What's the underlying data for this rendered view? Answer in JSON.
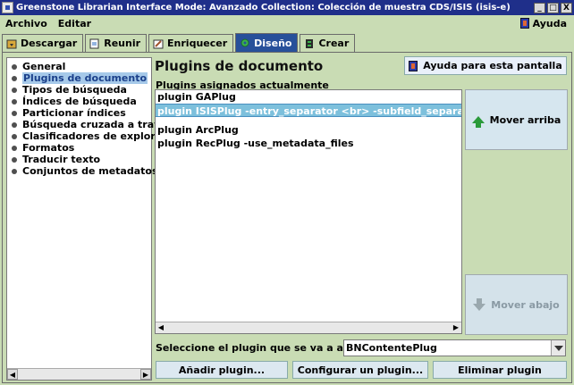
{
  "window": {
    "title": "Greenstone Librarian Interface  Mode: Avanzado  Collection: Colección de muestra CDS/ISIS (isis-e)",
    "minimize": "_",
    "maximize": "□",
    "close": "X"
  },
  "menu": {
    "file": "Archivo",
    "edit": "Editar",
    "help": "Ayuda"
  },
  "tabs": [
    {
      "label": "Descargar"
    },
    {
      "label": "Reunir"
    },
    {
      "label": "Enriquecer"
    },
    {
      "label": "Diseño"
    },
    {
      "label": "Crear"
    }
  ],
  "sidebar": {
    "items": [
      {
        "label": "General"
      },
      {
        "label": "Plugins de documento"
      },
      {
        "label": "Tipos de búsqueda"
      },
      {
        "label": "Índices de búsqueda"
      },
      {
        "label": "Particionar índices"
      },
      {
        "label": "Búsqueda cruzada a través"
      },
      {
        "label": "Clasificadores de exploraci"
      },
      {
        "label": "Formatos"
      },
      {
        "label": "Traducir texto"
      },
      {
        "label": "Conjuntos de metadatos"
      }
    ]
  },
  "main": {
    "heading": "Plugins de documento",
    "help_button": "Ayuda para esta pantalla",
    "assigned_label": "Plugins asignados actualmente",
    "plugins": [
      "plugin GAPlug",
      "plugin ISISPlug -entry_separator <br> -subfield_separator \", \"",
      "plugin ArcPlug",
      "plugin RecPlug -use_metadata_files"
    ],
    "move_up": "Mover arriba",
    "move_down": "Mover abajo",
    "select_label": "Seleccione el plugin que se va a añadir",
    "select_value": "BNContentePlug",
    "add_button": "Añadir plugin...",
    "configure_button": "Configurar un plugin...",
    "remove_button": "Eliminar plugin"
  },
  "colors": {
    "titlebar": "#1f2f8a",
    "background": "#c9dcb4",
    "active_tab": "#27509a",
    "selection": "#7dc0dc"
  }
}
